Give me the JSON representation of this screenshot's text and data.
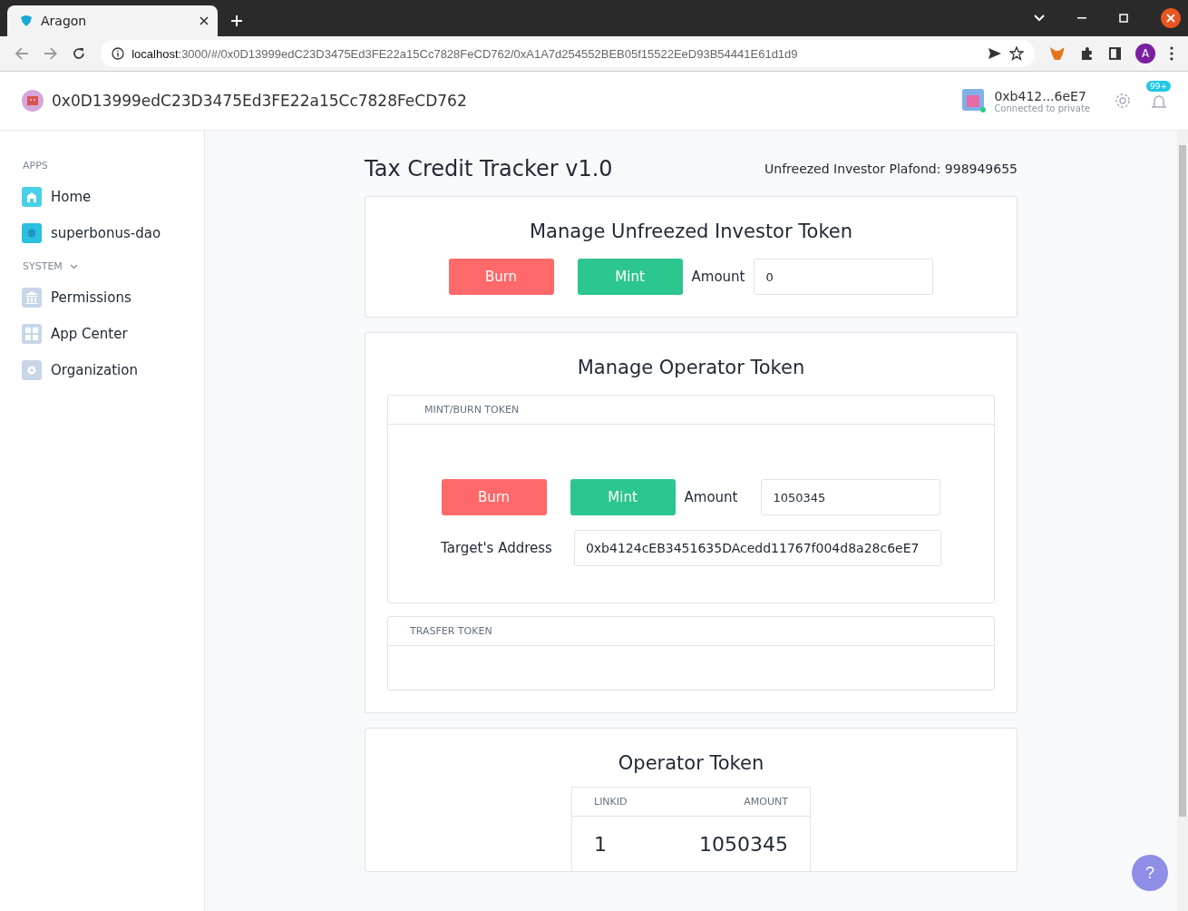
{
  "browser": {
    "tab_title": "Aragon",
    "url_host": "localhost",
    "url_path": ":3000/#/0x0D13999edC23D3475Ed3FE22a15Cc7828FeCD762/0xA1A7d254552BEB05f15522EeD93B54441E61d1d9",
    "profile_initial": "A"
  },
  "header": {
    "org_address": "0x0D13999edC23D3475Ed3FE22a15Cc7828FeCD762",
    "account_address": "0xb412...6eE7",
    "network": "Connected to private",
    "notifications": "99+"
  },
  "sidebar": [
    {
      "heading": "APPS",
      "collapsible": false,
      "items": [
        {
          "label": "Home",
          "kind": "home"
        },
        {
          "label": "superbonus-dao",
          "kind": "app"
        }
      ]
    },
    {
      "heading": "SYSTEM",
      "collapsible": true,
      "items": [
        {
          "label": "Permissions",
          "kind": "permissions"
        },
        {
          "label": "App Center",
          "kind": "appcenter"
        },
        {
          "label": "Organization",
          "kind": "organization"
        }
      ]
    }
  ],
  "main": {
    "title": "Tax Credit Tracker v1.0",
    "plafond": "Unfreezed Investor Plafond: 998949655",
    "investor_card": {
      "title": "Manage Unfreezed Investor Token",
      "buttons": [
        {
          "label": "Burn",
          "kind": "burn"
        },
        {
          "label": "Mint",
          "kind": "mint"
        }
      ],
      "amount_label": "Amount",
      "amount_value": "0"
    },
    "operator_card": {
      "title": "Manage Operator Token",
      "mint_burn": {
        "heading": "MINT/BURN TOKEN",
        "buttons": [
          {
            "label": "Burn",
            "kind": "burn"
          },
          {
            "label": "Mint",
            "kind": "mint"
          }
        ],
        "amount_label": "Amount",
        "amount_value": "1050345",
        "target_label": "Target's Address",
        "target_value": "0xb4124cEB3451635DAcedd11767f004d8a28c6eE7"
      },
      "transfer": {
        "heading": "TRASFER TOKEN"
      }
    },
    "operator_token": {
      "title": "Operator Token",
      "columns": [
        "LINKID",
        "AMOUNT"
      ],
      "rows": [
        [
          "1",
          "1050345"
        ]
      ]
    }
  },
  "help": "?"
}
